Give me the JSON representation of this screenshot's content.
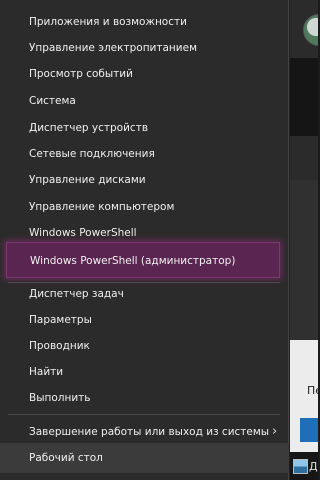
{
  "menu": {
    "group1": [
      "Приложения и возможности",
      "Управление электропитанием",
      "Просмотр событий",
      "Система",
      "Диспетчер устройств",
      "Сетевые подключения",
      "Управление дисками",
      "Управление компьютером",
      "Windows PowerShell",
      "Windows PowerShell (администратор)"
    ],
    "group2": [
      "Диспетчер задач",
      "Параметры",
      "Проводник",
      "Найти",
      "Выполнить"
    ],
    "group3": [
      "Завершение работы или выход из системы",
      "Рабочий стол"
    ],
    "selected_item": "Windows PowerShell (администратор)",
    "accent_color": "#5a2550"
  },
  "background": {
    "side_label": "Пе",
    "taskbar_label": "Ди"
  }
}
